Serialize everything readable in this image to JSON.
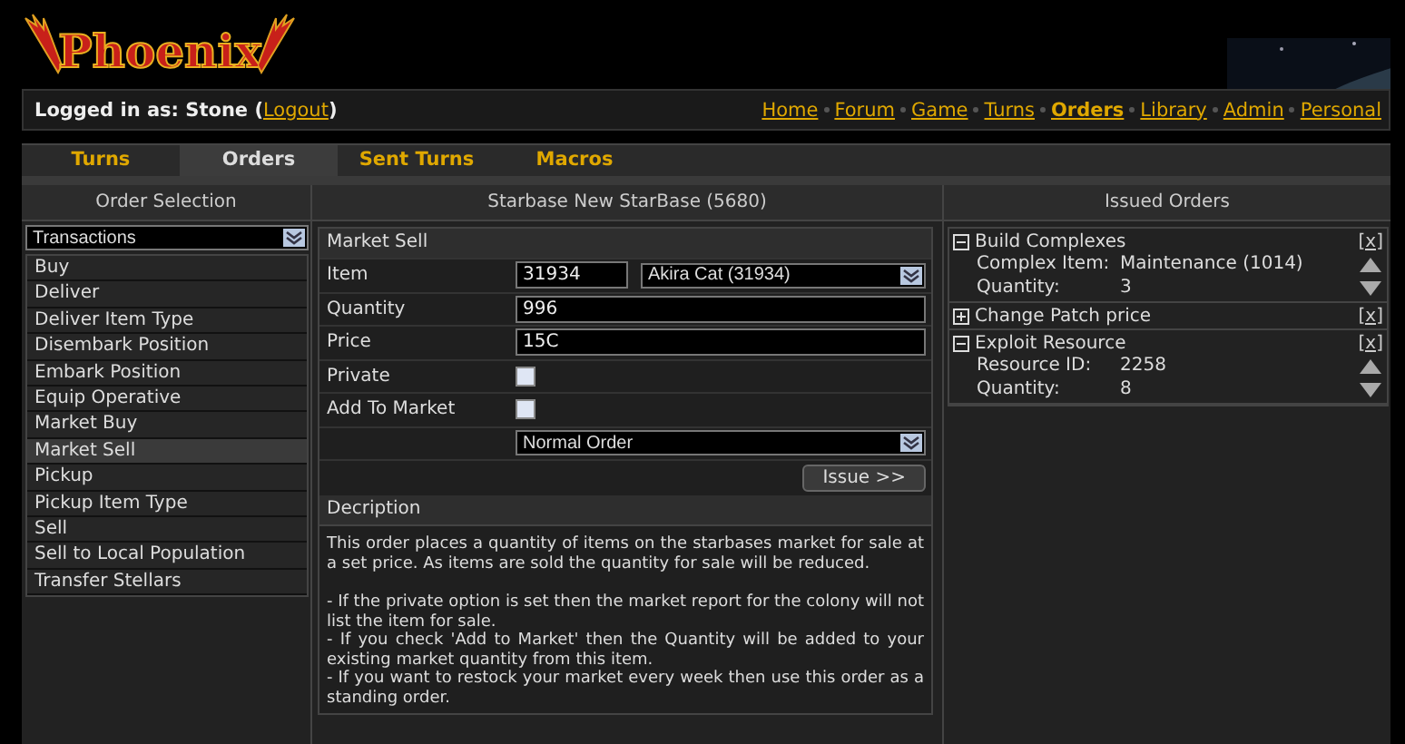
{
  "logo": {
    "text": "Phoenix"
  },
  "login": {
    "prefix": "Logged in as:",
    "user": "Stone",
    "open_paren": "(",
    "logout": "Logout",
    "close_paren": ")"
  },
  "nav": [
    {
      "label": "Home",
      "selected": false
    },
    {
      "label": "Forum",
      "selected": false
    },
    {
      "label": "Game",
      "selected": false
    },
    {
      "label": "Turns",
      "selected": false
    },
    {
      "label": "Orders",
      "selected": true
    },
    {
      "label": "Library",
      "selected": false
    },
    {
      "label": "Admin",
      "selected": false
    },
    {
      "label": "Personal",
      "selected": false
    }
  ],
  "tabs": [
    {
      "label": "Turns",
      "selected": false
    },
    {
      "label": "Orders",
      "selected": true
    },
    {
      "label": "Sent Turns",
      "selected": false
    },
    {
      "label": "Macros",
      "selected": false
    }
  ],
  "order_selection": {
    "title": "Order Selection",
    "category": "Transactions",
    "items": [
      {
        "label": "Buy",
        "selected": false
      },
      {
        "label": "Deliver",
        "selected": false
      },
      {
        "label": "Deliver Item Type",
        "selected": false
      },
      {
        "label": "Disembark Position",
        "selected": false
      },
      {
        "label": "Embark Position",
        "selected": false
      },
      {
        "label": "Equip Operative",
        "selected": false
      },
      {
        "label": "Market Buy",
        "selected": false
      },
      {
        "label": "Market Sell",
        "selected": true
      },
      {
        "label": "Pickup",
        "selected": false
      },
      {
        "label": "Pickup Item Type",
        "selected": false
      },
      {
        "label": "Sell",
        "selected": false
      },
      {
        "label": "Sell to Local Population",
        "selected": false
      },
      {
        "label": "Transfer Stellars",
        "selected": false
      }
    ]
  },
  "starbase": {
    "title": "Starbase New StarBase (5680)",
    "form_title": "Market Sell",
    "fields": [
      {
        "kind": "item",
        "label": "Item",
        "value": "31934",
        "option": "Akira Cat (31934)"
      },
      {
        "kind": "text",
        "label": "Quantity",
        "value": "996"
      },
      {
        "kind": "text",
        "label": "Price",
        "value": "15C"
      },
      {
        "kind": "checkbox",
        "label": "Private",
        "checked": false
      },
      {
        "kind": "checkbox",
        "label": "Add To Market",
        "checked": false
      },
      {
        "kind": "select",
        "option": "Normal Order"
      }
    ],
    "issue_button": "Issue >>",
    "description_title": "Decription",
    "description": [
      "This order places a quantity of items on the starbases market for sale at a set price. As items are sold the quantity for sale will be reduced.",
      "- If the private option is set then the market report for the colony will not list the item for sale.",
      "- If you check 'Add to Market' then the Quantity will be added to your existing market quantity from this item.",
      "- If you want to restock your market every week then use this order as a standing order."
    ]
  },
  "issued_orders": {
    "title": "Issued Orders",
    "orders": [
      {
        "title": "Build Complexes",
        "expanded": true,
        "close": "[x]",
        "fields": [
          {
            "label": "Complex Item:",
            "value": "Maintenance (1014)"
          },
          {
            "label": "Quantity:",
            "value": "3"
          }
        ]
      },
      {
        "title": "Change Patch price",
        "expanded": false,
        "close": "[x]"
      },
      {
        "title": "Exploit Resource",
        "expanded": true,
        "close": "[x]",
        "fields": [
          {
            "label": "Resource ID:",
            "value": "2258"
          },
          {
            "label": "Quantity:",
            "value": "8"
          }
        ]
      }
    ]
  }
}
